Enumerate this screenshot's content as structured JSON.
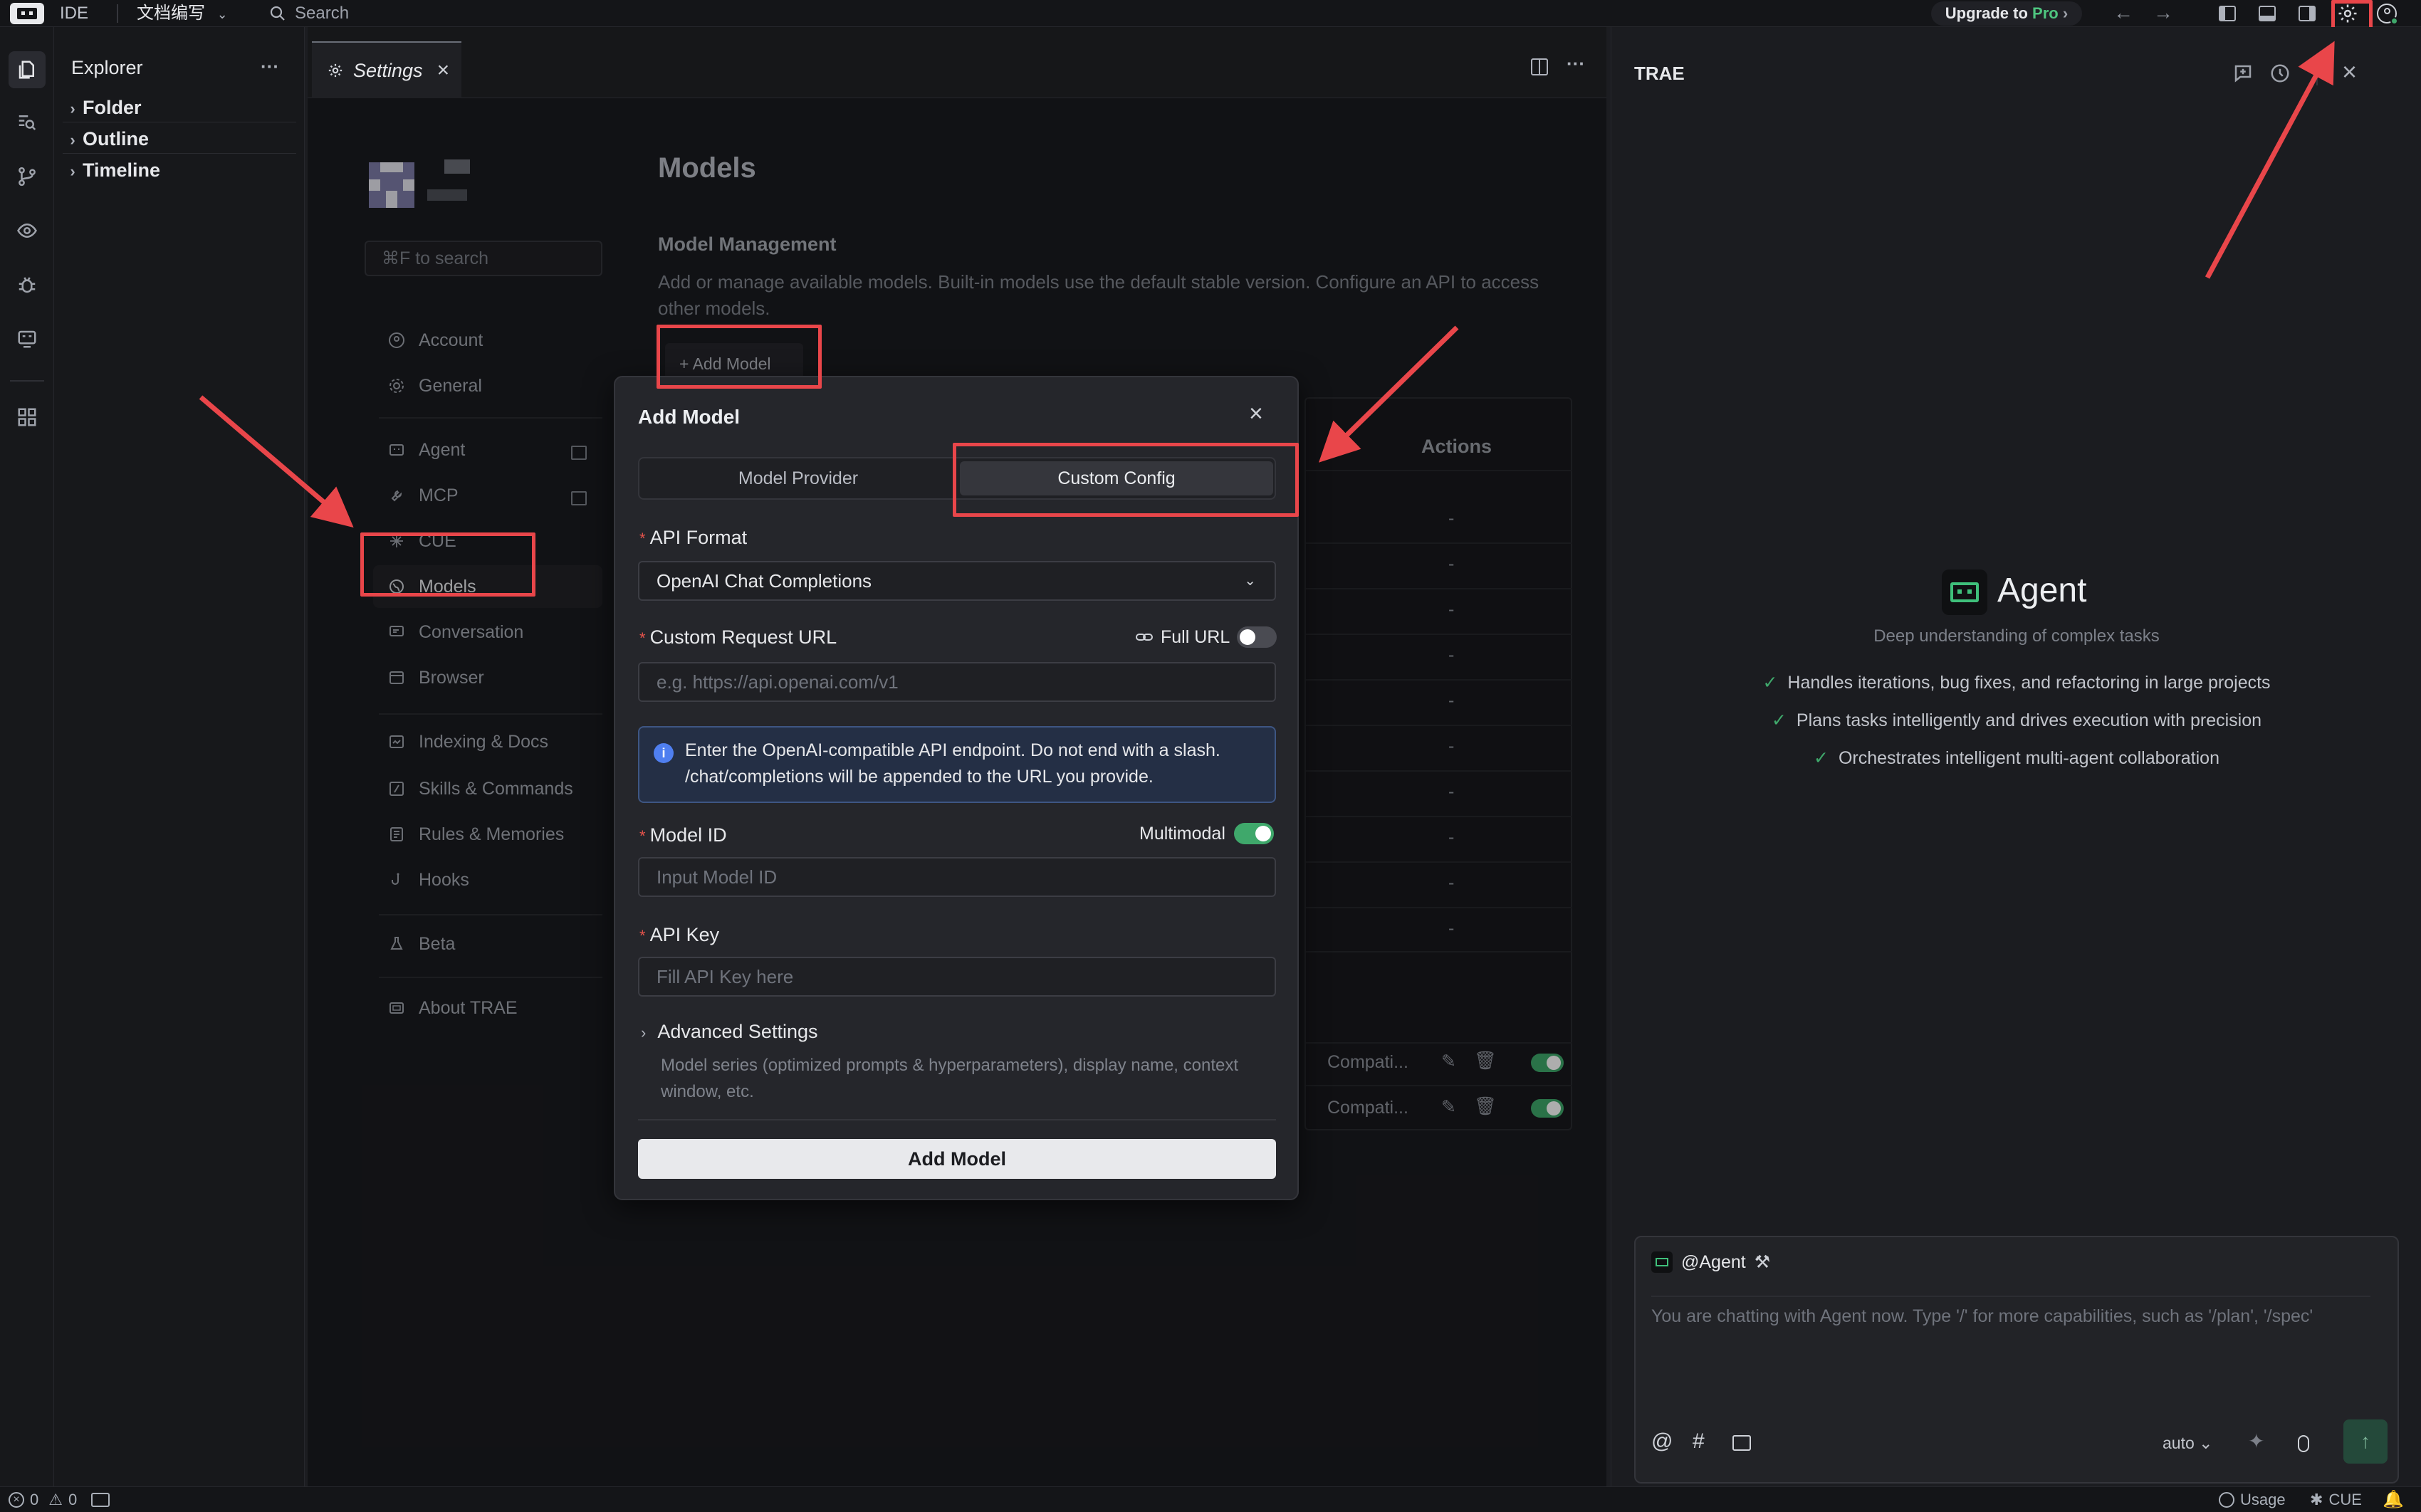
{
  "topbar": {
    "ide_label": "IDE",
    "workspace": "文档编写",
    "search": "Search",
    "upgrade_prefix": "Upgrade to",
    "upgrade_pro": "Pro",
    "upgrade_arrow": "›"
  },
  "activity_icons": [
    "files-icon",
    "search-panel-icon",
    "source-control-icon",
    "preview-icon",
    "debug-icon",
    "remote-icon",
    "extensions-icon"
  ],
  "explorer": {
    "title": "Explorer",
    "more": "···",
    "items": [
      "Folder",
      "Outline",
      "Timeline"
    ]
  },
  "editor": {
    "tab_label": "Settings",
    "tab_close": "×"
  },
  "settings": {
    "search_placeholder": "⌘F to search",
    "nav": [
      "Account",
      "General",
      "Agent",
      "MCP",
      "CUE",
      "Models",
      "Conversation",
      "Browser",
      "Indexing & Docs",
      "Skills & Commands",
      "Rules & Memories",
      "Hooks",
      "Beta",
      "About TRAE"
    ],
    "page_title": "Models",
    "section_title": "Model Management",
    "section_desc": "Add or manage available models. Built-in models use the default stable version. Configure an API to access other models.",
    "add_model_button": "Add Model",
    "table": {
      "actions_header": "Actions",
      "dash": "-",
      "row_compat": "Compati..."
    }
  },
  "modal": {
    "title": "Add Model",
    "close": "×",
    "tabs": [
      "Model Provider",
      "Custom Config"
    ],
    "api_format_label": "API Format",
    "api_format_value": "OpenAI Chat Completions",
    "url_label": "Custom Request URL",
    "full_url_label": "Full URL",
    "url_placeholder": "e.g. https://api.openai.com/v1",
    "info_text": "Enter the OpenAI-compatible API endpoint. Do not end with a slash. /chat/completions will be appended to the URL you provide.",
    "model_id_label": "Model ID",
    "multimodal_label": "Multimodal",
    "model_id_placeholder": "Input Model ID",
    "api_key_label": "API Key",
    "api_key_placeholder": "Fill API Key here",
    "advanced_title": "Advanced Settings",
    "advanced_desc": "Model series (optimized prompts & hyperparameters), display name, context window, etc.",
    "submit": "Add Model",
    "required_mark": "*"
  },
  "right_panel": {
    "title": "TRAE",
    "agent_title": "Agent",
    "agent_subtitle": "Deep understanding of complex tasks",
    "features": [
      "Handles iterations, bug fixes, and refactoring in large projects",
      "Plans tasks intelligently and drives execution with precision",
      "Orchestrates intelligent multi-agent collaboration"
    ],
    "chat_agent": "@Agent",
    "chat_placeholder": "You are chatting with Agent now. Type '/' for more capabilities, such as '/plan', '/spec'",
    "mode": "auto"
  },
  "status": {
    "errors": "0",
    "warnings": "0",
    "usage": "Usage",
    "cue": "CUE"
  },
  "colors": {
    "accent_green": "#3fa86b",
    "highlight_red": "#e9464a",
    "info_blue": "#4f7ff0"
  }
}
